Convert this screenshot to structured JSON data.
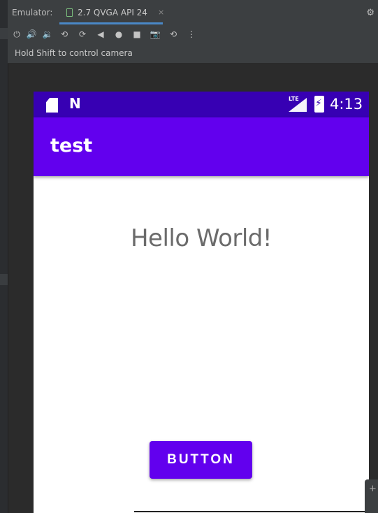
{
  "ide": {
    "panel_label": "Emulator:",
    "device_tab": "2.7 QVGA API 24",
    "tab_close": "×",
    "hint": "Hold Shift to control camera",
    "settings_icon": "gear-icon",
    "colors": {
      "background": "#2b2b2b",
      "panel": "#3c3f41",
      "tab_underline": "#4a88c7"
    },
    "toolbar": [
      {
        "name": "power-icon",
        "glyph": "⏻"
      },
      {
        "name": "volume-up-icon",
        "glyph": "🔊"
      },
      {
        "name": "volume-down-icon",
        "glyph": "🔉"
      },
      {
        "name": "rotate-left-icon",
        "glyph": "⟲"
      },
      {
        "name": "rotate-right-icon",
        "glyph": "⟳"
      },
      {
        "name": "back-icon",
        "glyph": "◀"
      },
      {
        "name": "home-icon",
        "glyph": "●"
      },
      {
        "name": "overview-icon",
        "glyph": "■"
      },
      {
        "name": "screenshot-icon",
        "glyph": "📷"
      },
      {
        "name": "snapshot-icon",
        "glyph": "⟲"
      },
      {
        "name": "more-icon",
        "glyph": "⋮"
      }
    ]
  },
  "phone": {
    "status_bar": {
      "sd_icon": "sd-card-icon",
      "notification_icon": "n-icon",
      "signal_label": "LTE",
      "time": "4:13",
      "color": "#3700b3"
    },
    "app_bar": {
      "title": "test",
      "color": "#6200ee"
    },
    "content": {
      "text": "Hello World!"
    },
    "button": {
      "label": "BUTTON",
      "color": "#6200ee"
    }
  }
}
